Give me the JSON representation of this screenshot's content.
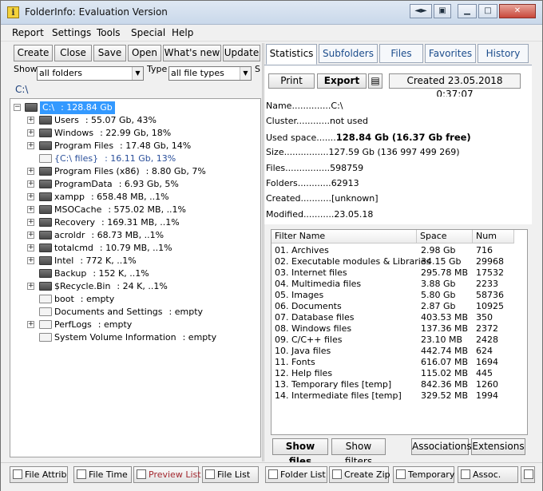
{
  "window": {
    "title": "FolderInfo: Evaluation Version",
    "app_icon": "i"
  },
  "menu": [
    "Report",
    "Settings",
    "Tools",
    "Special",
    "Help"
  ],
  "toolbar": [
    "Create",
    "Close",
    "Save",
    "Open",
    "What's new",
    "Update"
  ],
  "filters": {
    "show_label": "Show",
    "show_value": "all folders",
    "type_label": "Type",
    "type_value": "all file types",
    "s_label": "S"
  },
  "path": "C:\\",
  "tree": [
    {
      "label": "C:\\",
      "info": ": 128.84 Gb",
      "selected": true,
      "expander": "minus",
      "folder": "dark"
    },
    {
      "label": "Users",
      "info": ": 55.07 Gb, 43%",
      "expander": "plus",
      "folder": "dark"
    },
    {
      "label": "Windows",
      "info": ": 22.99 Gb, 18%",
      "expander": "plus",
      "folder": "dark"
    },
    {
      "label": "Program Files",
      "info": ": 17.48 Gb, 14%",
      "expander": "plus",
      "folder": "dark"
    },
    {
      "label": "{C:\\ files}",
      "info": ": 16.11 Gb, 13%",
      "expander": "none",
      "folder": "light",
      "note": true
    },
    {
      "label": "Program Files (x86)",
      "info": ": 8.80 Gb, 7%",
      "expander": "plus",
      "folder": "dark"
    },
    {
      "label": "ProgramData",
      "info": ": 6.93 Gb, 5%",
      "expander": "plus",
      "folder": "dark"
    },
    {
      "label": "xampp",
      "info": ": 658.48 MB, ..1%",
      "expander": "plus",
      "folder": "dark"
    },
    {
      "label": "MSOCache",
      "info": ": 575.02 MB, ..1%",
      "expander": "plus",
      "folder": "dark"
    },
    {
      "label": "Recovery",
      "info": ": 169.31 MB, ..1%",
      "expander": "plus",
      "folder": "dark"
    },
    {
      "label": "acroldr",
      "info": ": 68.73 MB, ..1%",
      "expander": "plus",
      "folder": "dark"
    },
    {
      "label": "totalcmd",
      "info": ": 10.79 MB, ..1%",
      "expander": "plus",
      "folder": "dark"
    },
    {
      "label": "Intel",
      "info": ": 772 K, ..1%",
      "expander": "plus",
      "folder": "dark"
    },
    {
      "label": "Backup",
      "info": ": 152 K, ..1%",
      "expander": "none",
      "folder": "dark"
    },
    {
      "label": "$Recycle.Bin",
      "info": ": 24 K, ..1%",
      "expander": "plus",
      "folder": "dark"
    },
    {
      "label": "boot",
      "info": ": empty",
      "expander": "none",
      "folder": "light"
    },
    {
      "label": "Documents and Settings",
      "info": ": empty",
      "expander": "none",
      "folder": "light"
    },
    {
      "label": "PerfLogs",
      "info": ": empty",
      "expander": "plus",
      "folder": "light"
    },
    {
      "label": "System Volume Information",
      "info": ": empty",
      "expander": "none",
      "folder": "light"
    }
  ],
  "tabs": [
    "Statistics",
    "Subfolders",
    "Files",
    "Favorites",
    "History"
  ],
  "stats_toolbar": {
    "print": "Print",
    "export": "Export",
    "created": "Created 23.05.2018 0:37:07"
  },
  "stats": [
    {
      "key": "Name..............",
      "value": "C:\\"
    },
    {
      "key": "Cluster............",
      "value": "not used"
    },
    {
      "key": "Used space.......",
      "value": "128.84 Gb (16.37 Gb free)",
      "bold": true
    },
    {
      "key": "Size................",
      "value": "127.59 Gb (136 997 499 269)"
    },
    {
      "key": "Files................",
      "value": "598759"
    },
    {
      "key": "Folders............",
      "value": "62913"
    },
    {
      "key": "Created...........",
      "value": "[unknown]"
    },
    {
      "key": "Modified...........",
      "value": "23.05.18"
    }
  ],
  "filter_table": {
    "headers": [
      "Filter Name",
      "Space",
      "Num"
    ],
    "rows": [
      [
        "01. Archives",
        "2.98 Gb",
        "716"
      ],
      [
        "02. Executable modules & Libraries",
        "34.15 Gb",
        "29968"
      ],
      [
        "03. Internet files",
        "295.78 MB",
        "17532"
      ],
      [
        "04. Multimedia files",
        "3.88 Gb",
        "2233"
      ],
      [
        "05. Images",
        "5.80 Gb",
        "58736"
      ],
      [
        "06. Documents",
        "2.87 Gb",
        "10925"
      ],
      [
        "07. Database files",
        "403.53 MB",
        "350"
      ],
      [
        "08. Windows files",
        "137.36 MB",
        "2372"
      ],
      [
        "09. C/C++ files",
        "23.10 MB",
        "2428"
      ],
      [
        "10. Java files",
        "442.74 MB",
        "624"
      ],
      [
        "11. Fonts",
        "616.07 MB",
        "1694"
      ],
      [
        "12. Help files",
        "115.02 MB",
        "445"
      ],
      [
        "13. Temporary files [temp]",
        "842.36 MB",
        "1260"
      ],
      [
        "14. Intermediate files [temp]",
        "329.52 MB",
        "1994"
      ]
    ]
  },
  "bottom_panel_buttons": [
    "Show files",
    "Show filters",
    "Associations",
    "Extensions"
  ],
  "bottom_bar": [
    "File Attrib",
    "File Time",
    "Preview List",
    "File List",
    "Folder List",
    "Create Zip",
    "Temporary",
    "Assoc."
  ],
  "colors": {
    "selection": "#3399ff",
    "tab_text": "#1b4c8c",
    "preview_list": "#a3282f"
  }
}
